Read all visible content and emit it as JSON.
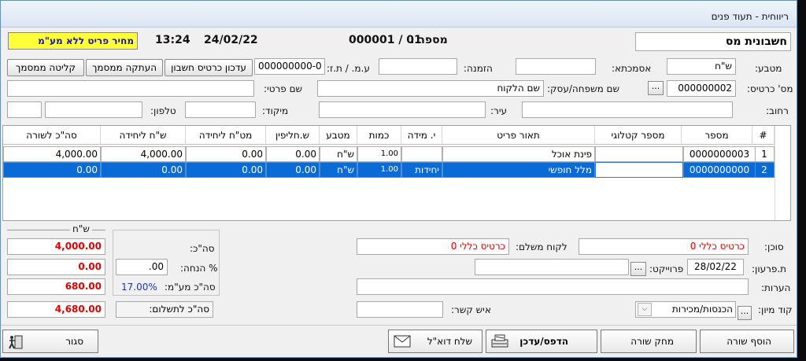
{
  "window": {
    "title": "ריווחית - תעוד פנים"
  },
  "header": {
    "doc_type": "חשבונית מס",
    "number_label": "מספר :",
    "number_value": "000001 / 01",
    "date": "24/02/22",
    "time": "13:24",
    "price_note": "מחיר פריט ללא מע\"מ"
  },
  "row1": {
    "currency_label": "מטבע:",
    "currency_value": "ש\"ח",
    "asmachta_label": "אסמכתא:",
    "asmachta_value": "",
    "order_label": "הזמנה:",
    "order_value": "",
    "vat_id_label": "ע.מ. / ת.ז:",
    "vat_id_value": "000000000-0",
    "btn_update_card": "עדכון כרטיס חשבון",
    "btn_copy_doc": "העתקה ממסמך",
    "btn_receive_doc": "קליטה ממסמך"
  },
  "row2": {
    "card_label": "מס' כרטיס:",
    "card_value": "000000002",
    "lastname_label": "שם משפחה/עסק:",
    "lastname_value": "שם הלקוח",
    "firstname_label": "שם פרטי:",
    "firstname_value": ""
  },
  "row3": {
    "street_label": "רחוב:",
    "street_value": "",
    "city_label": "עיר:",
    "city_value": "",
    "zip_label": "מיקוד:",
    "zip_value": "",
    "phone_label": "טלפון:",
    "phone_value": ""
  },
  "grid": {
    "columns": [
      "#",
      "מספר",
      "מספר קטלוגי",
      "תאור פריט",
      "י. מידה",
      "כמות",
      "מטבע",
      "ש.חליפין",
      "מט\"ח ליחידה",
      "ש\"ח ליחידה",
      "סה\"כ לשורה"
    ],
    "rows": [
      {
        "idx": "1",
        "number": "0000000003",
        "catalog": "",
        "desc": "פינת אוכל",
        "unit": "",
        "qty": "1.00",
        "currency": "ש\"ח",
        "rate": "0.00",
        "fx_unit": "0.00",
        "nis_unit": "4,000.00",
        "total": "4,000.00"
      },
      {
        "idx": "2",
        "number": "0000000000",
        "catalog": "",
        "desc": "מלל חופשי",
        "unit": "יחידות",
        "qty": "1.00",
        "currency": "ש\"ח",
        "rate": "0.00",
        "fx_unit": "0.00",
        "nis_unit": "0.00",
        "total": "0.00"
      }
    ]
  },
  "bottom": {
    "agent_label": "סוכן:",
    "agent_value": "כרטיס כללי 0",
    "payer_label": "לקוח משלם:",
    "payer_value": "כרטיס כללי 0",
    "due_label": "ת.פרעון:",
    "due_value": "28/02/22",
    "project_label": "פרוייקט:",
    "project_value": "",
    "notes_label": "הערות:",
    "notes_value": "",
    "sort_label": "קוד מיון:",
    "sort_value": "הכנסות/מכירות",
    "contact_label": "איש קשר:",
    "contact_value": ""
  },
  "totals": {
    "currency_header": "ש\"ח",
    "subtotal_label": "סה\"כ:",
    "subtotal_value": "4,000.00",
    "discount_label": "% הנחה:",
    "discount_pct": ".00",
    "discount_value": "0.00",
    "vat_label": "סה\"כ מע\"מ:",
    "vat_pct": "17.00%",
    "vat_value": "680.00",
    "pay_label": "סה\"כ לתשלום:",
    "pay_value": "4,680.00"
  },
  "buttons": {
    "add_row": "הוסף שורה",
    "delete_row": "מחק שורה",
    "print_update": "הדפס/עדכן",
    "send_email": "שלח דוא\"ל",
    "close": "סגור"
  }
}
